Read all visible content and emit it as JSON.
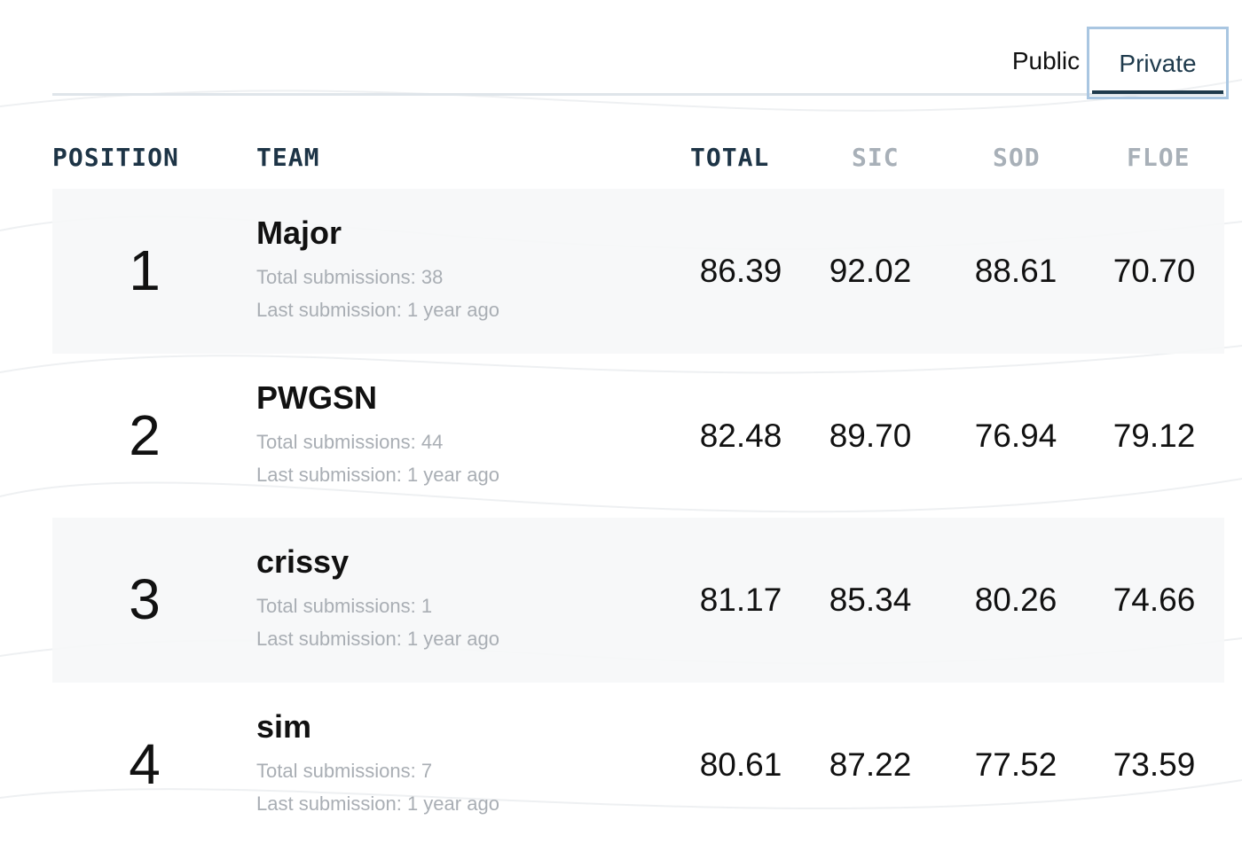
{
  "tabs": [
    {
      "label": "Public",
      "active": false
    },
    {
      "label": "Private",
      "active": true
    }
  ],
  "columns": {
    "position": "POSITION",
    "team": "TEAM",
    "total": "TOTAL",
    "sic": "SIC",
    "sod": "SOD",
    "floe": "FLOE"
  },
  "rows": [
    {
      "position": "1",
      "team": "Major",
      "submissions": "Total submissions: 38",
      "last": "Last submission: 1 year ago",
      "total": "86.39",
      "sic": "92.02",
      "sod": "88.61",
      "floe": "70.70"
    },
    {
      "position": "2",
      "team": "PWGSN",
      "submissions": "Total submissions: 44",
      "last": "Last submission: 1 year ago",
      "total": "82.48",
      "sic": "89.70",
      "sod": "76.94",
      "floe": "79.12"
    },
    {
      "position": "3",
      "team": "crissy",
      "submissions": "Total submissions: 1",
      "last": "Last submission: 1 year ago",
      "total": "81.17",
      "sic": "85.34",
      "sod": "80.26",
      "floe": "74.66"
    },
    {
      "position": "4",
      "team": "sim",
      "submissions": "Total submissions: 7",
      "last": "Last submission: 1 year ago",
      "total": "80.61",
      "sic": "87.22",
      "sod": "77.52",
      "floe": "73.59"
    }
  ],
  "colors": {
    "accent_dark": "#1e3a4c",
    "tab_border": "#a9c6e1",
    "muted_text": "#a9aeb4",
    "row_shade": "#f6f7f8"
  }
}
